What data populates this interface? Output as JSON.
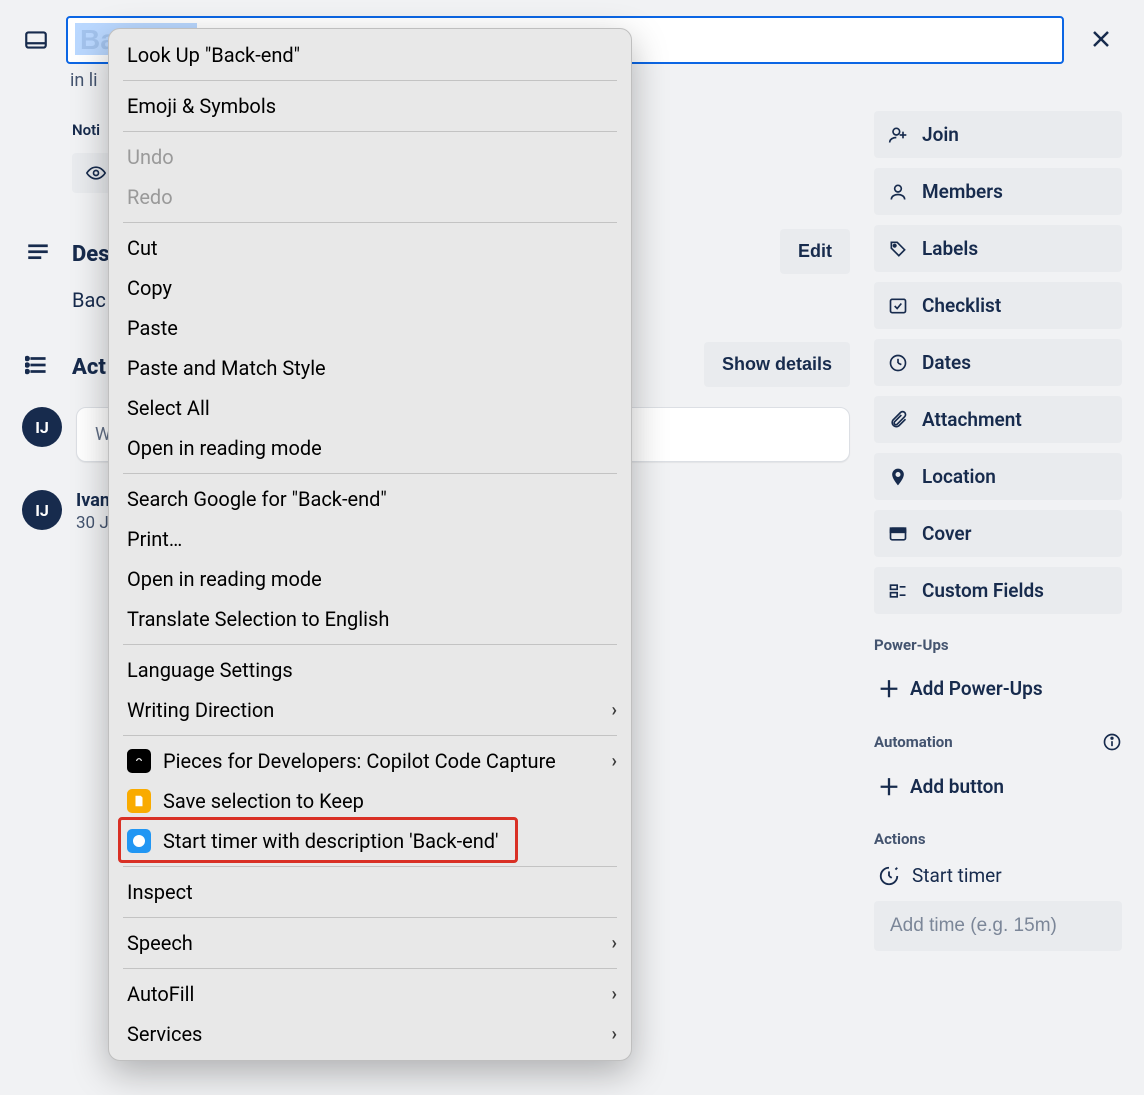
{
  "title": {
    "value": "Back-",
    "full": "Back-end",
    "subtitle_prefix": "in li"
  },
  "notifications": {
    "label": "Noti"
  },
  "description": {
    "heading": "Des",
    "edit_label": "Edit",
    "body_visible": "Bac"
  },
  "activity": {
    "heading": "Act",
    "show_details_label": "Show details",
    "comment_placeholder": "W",
    "comments": [
      {
        "author_initials": "IJ",
        "author_name": "Ivan",
        "timestamp": "30 J"
      }
    ],
    "composer_initials": "IJ"
  },
  "sidebar": {
    "buttons": [
      {
        "icon": "join",
        "label": "Join"
      },
      {
        "icon": "members",
        "label": "Members"
      },
      {
        "icon": "labels",
        "label": "Labels"
      },
      {
        "icon": "checklist",
        "label": "Checklist"
      },
      {
        "icon": "dates",
        "label": "Dates"
      },
      {
        "icon": "attachment",
        "label": "Attachment"
      },
      {
        "icon": "location",
        "label": "Location"
      },
      {
        "icon": "cover",
        "label": "Cover"
      },
      {
        "icon": "custom-fields",
        "label": "Custom Fields"
      }
    ],
    "powerups": {
      "label": "Power-Ups",
      "add_label": "Add Power-Ups"
    },
    "automation": {
      "label": "Automation",
      "add_label": "Add button"
    },
    "actions": {
      "label": "Actions",
      "start_timer_label": "Start timer",
      "time_input_placeholder": "Add time (e.g. 15m)"
    }
  },
  "context_menu": {
    "items": [
      {
        "type": "item",
        "label": "Look Up \"Back-end\""
      },
      {
        "type": "sep"
      },
      {
        "type": "item",
        "label": "Emoji & Symbols"
      },
      {
        "type": "sep"
      },
      {
        "type": "item",
        "label": "Undo",
        "disabled": true
      },
      {
        "type": "item",
        "label": "Redo",
        "disabled": true
      },
      {
        "type": "sep"
      },
      {
        "type": "item",
        "label": "Cut"
      },
      {
        "type": "item",
        "label": "Copy"
      },
      {
        "type": "item",
        "label": "Paste"
      },
      {
        "type": "item",
        "label": "Paste and Match Style"
      },
      {
        "type": "item",
        "label": "Select All"
      },
      {
        "type": "item",
        "label": "Open in reading mode"
      },
      {
        "type": "sep"
      },
      {
        "type": "item",
        "label": "Search Google for \"Back-end\""
      },
      {
        "type": "item",
        "label": "Print…"
      },
      {
        "type": "item",
        "label": "Open in reading mode"
      },
      {
        "type": "item",
        "label": "Translate Selection to English"
      },
      {
        "type": "sep"
      },
      {
        "type": "item",
        "label": "Language Settings"
      },
      {
        "type": "item",
        "label": "Writing Direction",
        "submenu": true
      },
      {
        "type": "sep"
      },
      {
        "type": "item",
        "label": "Pieces for Developers: Copilot  Code Capture",
        "icon": "pieces",
        "submenu": true
      },
      {
        "type": "item",
        "label": "Save selection to Keep",
        "icon": "keep"
      },
      {
        "type": "item",
        "label": "Start timer with description 'Back-end'",
        "icon": "clockify",
        "highlighted": true
      },
      {
        "type": "sep"
      },
      {
        "type": "item",
        "label": "Inspect"
      },
      {
        "type": "sep"
      },
      {
        "type": "item",
        "label": "Speech",
        "submenu": true
      },
      {
        "type": "sep"
      },
      {
        "type": "item",
        "label": "AutoFill",
        "submenu": true
      },
      {
        "type": "item",
        "label": "Services",
        "submenu": true
      }
    ]
  }
}
